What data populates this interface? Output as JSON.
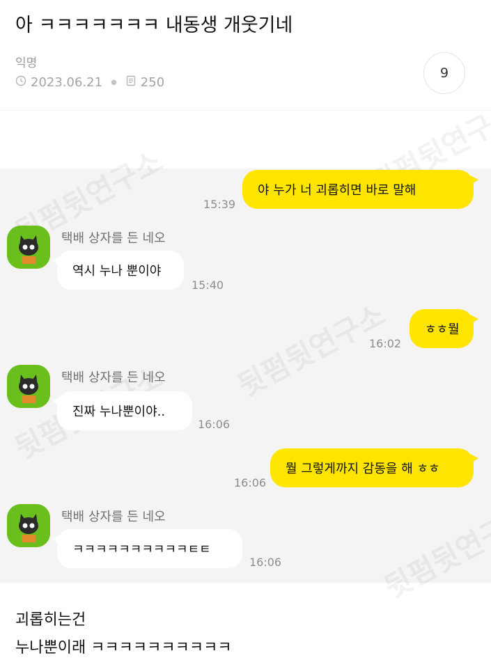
{
  "post": {
    "title": "아 ㅋㅋㅋㅋㅋㅋㅋ 내동생 개웃기네",
    "author": "익명",
    "date": "2023.06.21",
    "views": "250",
    "comment_count": "9"
  },
  "chat": {
    "messages": [
      {
        "side": "right",
        "text": "야 누가 너 괴롭히면 바로 말해",
        "time": "15:39"
      },
      {
        "side": "left",
        "sender": "택배 상자를 든 네오",
        "text": "역시 누나 뿐이야",
        "time": "15:40"
      },
      {
        "side": "right",
        "text": "ㅎㅎ뭘",
        "time": "16:02"
      },
      {
        "side": "left",
        "sender": "택배 상자를 든 네오",
        "text": "진짜 누나뿐이야..",
        "time": "16:06"
      },
      {
        "side": "right",
        "text": "뭘 그렇게까지 감동을 해 ㅎㅎ",
        "time": "16:06"
      },
      {
        "side": "left",
        "sender": "택배 상자를 든 네오",
        "text": "ㅋㅋㅋㅋㅋㅋㅋㅋㅋㅋㅌㅌ",
        "time": "16:06"
      }
    ]
  },
  "body_text": {
    "line1": "괴롭히는건",
    "line2": "누나뿐이래 ㅋㅋㅋㅋㅋㅋㅋㅋㅋㅋ"
  },
  "watermark": "뒷펌뒷연구소",
  "colors": {
    "my_bubble": "#fee500",
    "their_bubble": "#ffffff",
    "chat_background": "#f4f4f4",
    "avatar_green": "#6abf1c"
  },
  "icons": {
    "date": "clock-icon",
    "views": "document-icon"
  }
}
